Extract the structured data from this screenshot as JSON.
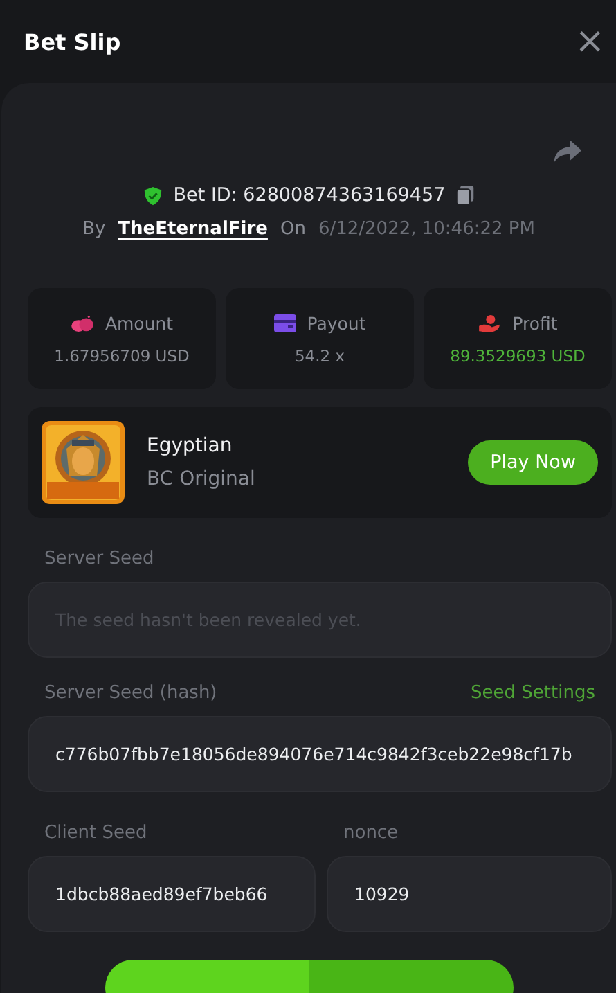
{
  "header": {
    "title": "Bet Slip",
    "close": "×"
  },
  "bet": {
    "id_label": "Bet ID: 62800874363169457",
    "by_label": "By",
    "user": "TheEternalFire",
    "on_label": "On",
    "date": "6/12/2022, 10:46:22 PM"
  },
  "stats": [
    {
      "kind": "amount",
      "label": "Amount",
      "value": "1.67956709 USD",
      "highlight": false
    },
    {
      "kind": "payout",
      "label": "Payout",
      "value": "54.2 x",
      "highlight": false
    },
    {
      "kind": "profit",
      "label": "Profit",
      "value": "89.3529693 USD",
      "highlight": true
    }
  ],
  "game": {
    "title": "Egyptian",
    "subtitle": "BC Original",
    "button": "Play Now"
  },
  "server_seed": {
    "label": "Server Seed",
    "placeholder": "The seed hasn't been revealed yet."
  },
  "server_seed_hash": {
    "label": "Server Seed (hash)",
    "link": "Seed Settings",
    "value": "c776b07fbb7e18056de894076e714c9842f3ceb22e98cf17b"
  },
  "client_seed": {
    "label": "Client Seed",
    "value": "1dbcb88aed89ef7beb66"
  },
  "nonce": {
    "label": "nonce",
    "value": "10929"
  }
}
